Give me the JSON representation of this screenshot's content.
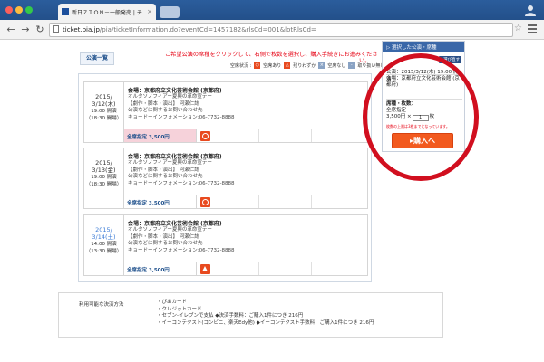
{
  "browser": {
    "tab_title": "新日ＺＴＯＮ－一般発売 | チ",
    "tab_close": "×",
    "url_host": "ticket.pia.jp",
    "url_path": "/pia/ticketInformation.do?eventCd=1457182&rlsCd=001&lotRlsCd=",
    "traffic_lights": [
      "#fc605c",
      "#fdbc40",
      "#34c84a"
    ]
  },
  "page": {
    "list_button": "公演一覧",
    "instruction_line1": "ご希望公演の席種をクリックして、右側で枚数を選択し、購入手続きにお進みくださ",
    "instruction_line2": "い。",
    "legend": [
      {
        "label": "空席状況 :",
        "icon": ""
      },
      {
        "label": "空席あり",
        "icon": "○",
        "color": "#e84a1f"
      },
      {
        "label": "残りわずか",
        "icon": "△",
        "color": "#e84a1f"
      },
      {
        "label": "空席なし",
        "icon": "×",
        "color": "#8aa3c4"
      },
      {
        "label": "取り扱い無し",
        "icon": "-",
        "color": "#8aa3c4"
      }
    ],
    "events": [
      {
        "date": "2015/",
        "date2": "3/12(木)",
        "start": "19:00 開演",
        "open": "（18:30 開場）",
        "venue": "会場：京都府立文化芸術会館 (京都府)",
        "line1": "オルタソノフィアー夏興の革命宣テー",
        "line2": "【劇作・脚本・演出】 河瀬仁誌",
        "line3": "公演などに関するお問い合わせ先",
        "line4": "キョードーインフォメーション:06-7732-8888",
        "price": "全席指定 3,500円",
        "status_icon": "circle-status-icon",
        "selected": true
      },
      {
        "date": "2015/",
        "date2": "3/13(金)",
        "start": "19:00 開演",
        "open": "（18:30 開場）",
        "venue": "会場：京都府立文化芸術会館 (京都府)",
        "line1": "オルタソノフィアー夏興の革命宣テー",
        "line2": "【劇作・脚本・演出】 河瀬仁誌",
        "line3": "公演などに関するお問い合わせ先",
        "line4": "キョードーインフォメーション:06-7732-8888",
        "price": "全席指定 3,500円",
        "status_icon": "circle-status-icon",
        "selected": false
      },
      {
        "date": "2015/",
        "date2": "3/14(土)",
        "start": "14:00 開演",
        "open": "（13:30 開場）",
        "venue": "会場：京都府立文化芸術会館 (京都府)",
        "line1": "オルタソノフィアー夏興の革命宣テー",
        "line2": "【劇作・脚本・演出】 河瀬仁誌",
        "line3": "公演などに関するお問い合わせ先",
        "line4": "キョードーインフォメーション:06-7732-8888",
        "price": "全席指定 3,500円",
        "status_icon": "triangle-status-icon",
        "selected": false
      }
    ],
    "payment": {
      "label": "利用可能な決済方法",
      "items": [
        "・ぴあカード",
        "・クレジットカード",
        "・セブン-イレブンで支払 ◆決済手数料：ご購入1件につき 216円",
        "・イーコンテクスト(コンビニ、楽天Edy他) ◆イーコンテクスト手数料：ご購入1件につき 216円"
      ]
    }
  },
  "panel": {
    "header": "▷ 選択した公演・席種",
    "change_button": "▶選び直す",
    "performance": "公演：2015/3/12(木) 19:00 開演",
    "venue": "会場：京都府立文化芸術会館 (京都府)",
    "seat_label": "席種・枚数：",
    "seat_type": "全席指定",
    "price": "3,500円 ×",
    "quantity": "1",
    "quantity_unit": "枚",
    "note": "枚数の上限は3枚までとなっています。",
    "buy_button": "▸購入へ"
  },
  "colors": {
    "accent": "#f25a1f",
    "highlight_ring": "#d10f1f",
    "selected_cell": "#f6d2da",
    "panel_header": "#3a67a8"
  }
}
